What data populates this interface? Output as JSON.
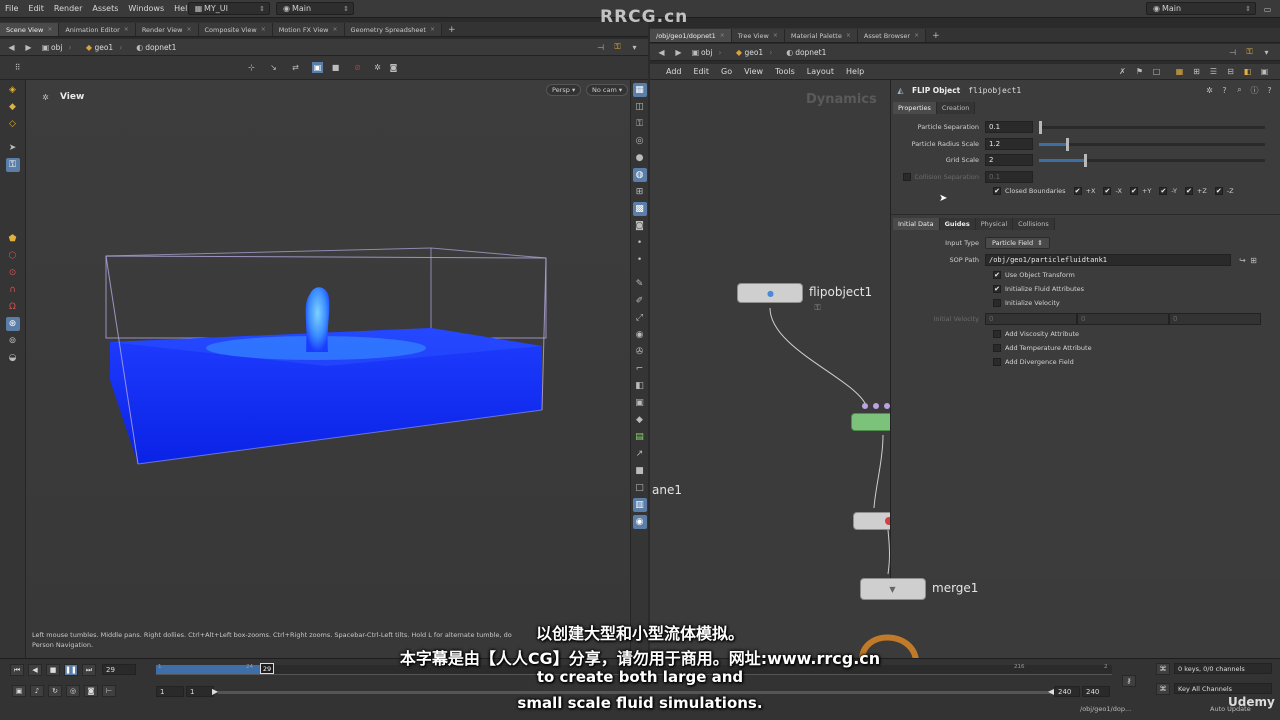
{
  "menubar": {
    "items": [
      "File",
      "Edit",
      "Render",
      "Assets",
      "Windows",
      "Help"
    ],
    "desktop": "MY_UI",
    "context": "Main",
    "right_context": "Main"
  },
  "brand": "RRCG.cn",
  "left_pane": {
    "tabs": [
      "Scene View",
      "Animation Editor",
      "Render View",
      "Composite View",
      "Motion FX View",
      "Geometry Spreadsheet"
    ],
    "path": [
      "obj",
      "geo1",
      "dopnet1"
    ],
    "view_title": "View",
    "persp": "Persp",
    "cam": "No cam",
    "hint": "Left mouse tumbles. Middle pans. Right dollies. Ctrl+Alt+Left box-zooms. Ctrl+Right zooms. Spacebar-Ctrl-Left tilts. Hold L for alternate tumble, do",
    "hint2": "Person Navigation."
  },
  "right_pane": {
    "tabs": [
      "/obj/geo1/dopnet1",
      "Tree View",
      "Material Palette",
      "Asset Browser"
    ],
    "path": [
      "obj",
      "geo1",
      "dopnet1"
    ],
    "menu": [
      "Add",
      "Edit",
      "Go",
      "View",
      "Tools",
      "Layout",
      "Help"
    ],
    "network_label": "Dynamics",
    "nodes": {
      "flipobject": "flipobject1",
      "plane": "ane1",
      "merge": "merge1"
    }
  },
  "params": {
    "node_type": "FLIP Object",
    "node_name": "flipobject1",
    "tabs": [
      "Properties",
      "Creation"
    ],
    "particle_separation": {
      "label": "Particle Separation",
      "value": "0.1",
      "level": 0.0
    },
    "particle_radius_scale": {
      "label": "Particle Radius Scale",
      "value": "1.2",
      "level": 0.12
    },
    "grid_scale": {
      "label": "Grid Scale",
      "value": "2",
      "level": 0.2
    },
    "collision_separation": {
      "label": "Collision Separation",
      "value": "0.1"
    },
    "closed_boundaries": "Closed Boundaries",
    "axes": [
      "+X",
      "-X",
      "+Y",
      "-Y",
      "+Z",
      "-Z"
    ],
    "sub_tabs": [
      "Initial Data",
      "Guides",
      "Physical",
      "Collisions"
    ],
    "input_type": {
      "label": "Input Type",
      "value": "Particle Field"
    },
    "sop_path": {
      "label": "SOP Path",
      "value": "/obj/geo1/particlefluidtank1"
    },
    "checks": [
      {
        "label": "Use Object Transform",
        "checked": true
      },
      {
        "label": "Initialize Fluid Attributes",
        "checked": true
      },
      {
        "label": "Initialize Velocity",
        "checked": false
      }
    ],
    "initial_velocity": {
      "label": "Initial Velocity",
      "values": [
        "0",
        "0",
        "0"
      ]
    },
    "checks2": [
      {
        "label": "Add Viscosity Attribute",
        "checked": false
      },
      {
        "label": "Add Temperature Attribute",
        "checked": false
      },
      {
        "label": "Add Divergence Field",
        "checked": false
      }
    ]
  },
  "timeline": {
    "current_frame": "29",
    "frame_marker": "29",
    "start": "1",
    "start2": "1",
    "end": "240",
    "end2": "240",
    "ticks": [
      "1",
      "24",
      "216",
      "2"
    ],
    "keys": "0 keys, 0/0 channels",
    "key_all": "Key All Channels",
    "auto_update": "Auto Update",
    "status_path": "/obj/geo1/dop..."
  },
  "subtitles": {
    "line1": "以创建大型和小型流体模拟。",
    "line2": "本字幕是由【人人CG】分享，请勿用于商用。网址:www.rrcg.cn",
    "line3": "to create both large and",
    "line4": "small scale fluid simulations."
  },
  "udemy": "Udemy"
}
